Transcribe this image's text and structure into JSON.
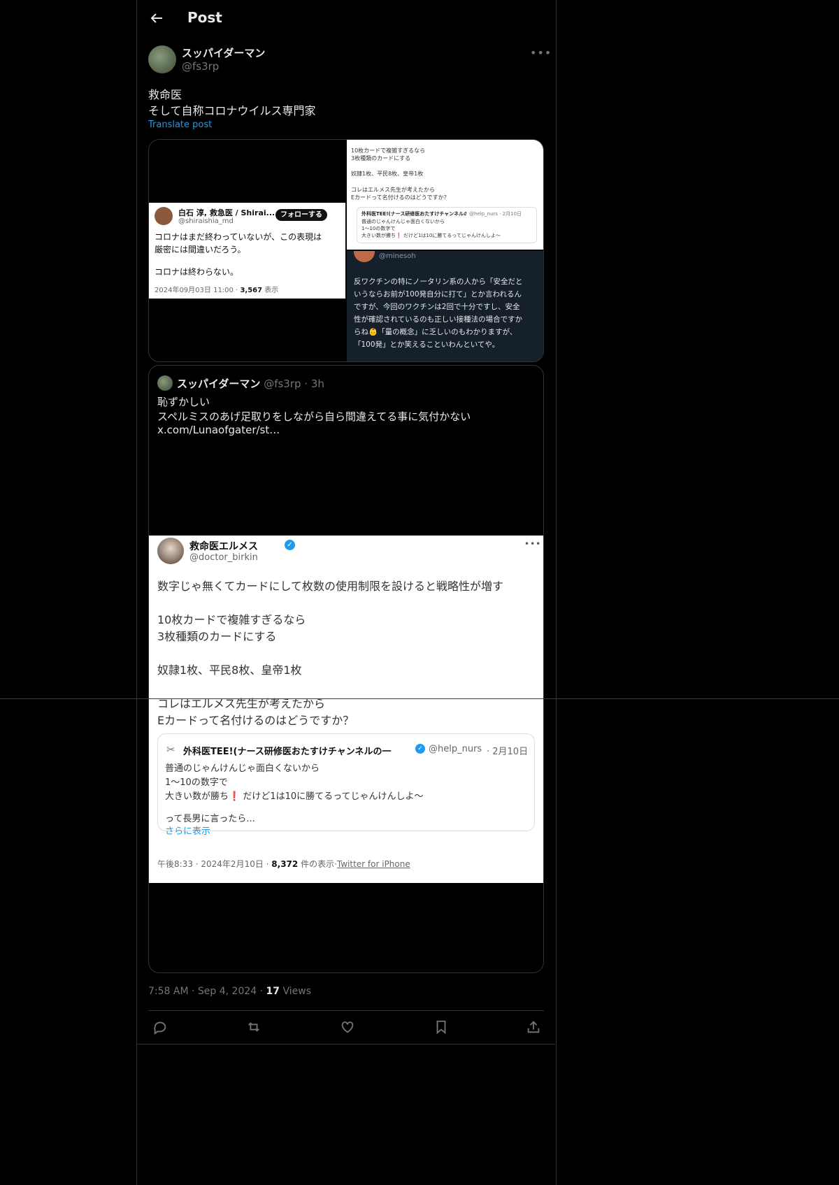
{
  "header": {
    "title": "Post"
  },
  "post": {
    "author_name": "スッパイダーマン",
    "author_handle": "@fs3rp",
    "text_line1": "救命医",
    "text_line2": "そして自称コロナウイルス専門家",
    "translate": "Translate post",
    "timestamp": "7:58 AM",
    "date": "Sep 4, 2024",
    "views_count": "17",
    "views_label": "Views"
  },
  "img1": {
    "name": "白石 淳, 救急医 / Shirai...",
    "handle": "@shiraishia_md",
    "follow": "フォローする",
    "line1": "コロナはまだ終わっていないが、この表現は",
    "line2": "厳密には間違いだろう。",
    "line3": "コロナは終わらない。",
    "meta": "2024年09月03日 11:00 · ",
    "views": "3,567",
    "views_suffix": " 表示"
  },
  "img2": {
    "line1": "10枚カードで複雑すぎるなら",
    "line2": "3枚種類のカードにする",
    "line3": "奴隷1枚、平民8枚、皇帝1枚",
    "line4": "コレはエルメス先生が考えたから",
    "line5": "Eカードって名付けるのはどうですか？",
    "q_name": "外科医TEE!(ナース研修医おたすけチャンネルの一",
    "q_meta": "@help_nurs · 2月10日",
    "q_line1": "普通のじゃんけんじゃ面白くないから",
    "q_line2": "1〜10の数字で",
    "q_line3": "大きい数が勝ち❗ だけど1は10に勝てるってじゃんけんしよ〜"
  },
  "img3": {
    "handle": "@minesoh",
    "line1": "反ワクチンの特にノータリン系の人から「安全だと",
    "line2": "いうならお前が100発自分に打て」とか言われるん",
    "line3": "ですが、今回のワクチンは2回で十分ですし、安全",
    "line4": "性が確認されているのも正しい接種法の場合ですか",
    "line5": "らね👶「量の概念」に乏しいのもわかりますが、",
    "line6": "「100発」とか笑えることいわんといてや。"
  },
  "quote": {
    "name": "スッパイダーマン",
    "handle": "@fs3rp",
    "time": "3h",
    "line1": "恥ずかしい",
    "line2": "スペルミスのあげ足取りをしながら自ら間違えてる事に気付かない",
    "line3": "x.com/Lunaofgater/st…"
  },
  "quote_image": {
    "name": "救命医エルメス",
    "handle": "@doctor_birkin",
    "line1": "数字じゃ無くてカードにして枚数の使用制限を設けると戦略性が増す",
    "line2": "10枚カードで複雑すぎるなら",
    "line3": "3枚種類のカードにする",
    "line4": "奴隷1枚、平民8枚、皇帝1枚",
    "line5": "コレはエルメス先生が考えたから",
    "line6": "Eカードって名付けるのはどうですか？",
    "nested_name": "外科医TEE!(ナース研修医おたすけチャンネルの一",
    "nested_handle": "@help_nurs",
    "nested_date": "· 2月10日",
    "nested_line1": "普通のじゃんけんじゃ面白くないから",
    "nested_line2": "1〜10の数字で",
    "nested_line3": "大きい数が勝ち❗ だけど1は10に勝てるってじゃんけんしよ〜",
    "nested_line4": "って長男に言ったら...",
    "nested_more": "さらに表示",
    "meta": "午後8:33 · 2024年2月10日 · ",
    "views": "8,372",
    "views_suffix": " 件の表示·",
    "client": "Twitter for iPhone"
  },
  "icons": [
    "back-arrow-icon",
    "more-icon",
    "reply-icon",
    "repost-icon",
    "like-icon",
    "bookmark-icon",
    "share-icon",
    "verified-icon"
  ]
}
